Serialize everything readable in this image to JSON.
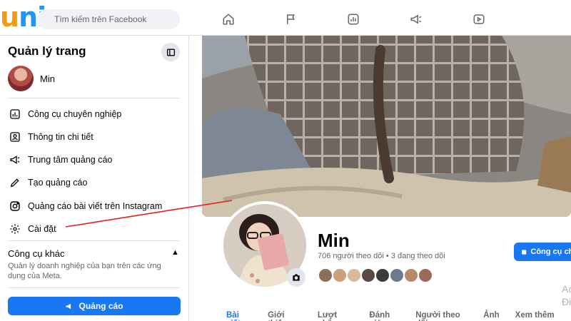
{
  "brand": {
    "logo_text_u": "u",
    "logo_text_nica": "nica"
  },
  "topbar": {
    "search_placeholder": "Tìm kiếm trên Facebook",
    "nav_icons": [
      "home-icon",
      "flag-icon",
      "insights-icon",
      "megaphone-icon",
      "video-icon"
    ]
  },
  "sidebar": {
    "title": "Quản lý trang",
    "profile_name": "Min",
    "items": [
      {
        "label": "Công cụ chuyên nghiệp",
        "icon": "bar-chart-icon"
      },
      {
        "label": "Thông tin chi tiết",
        "icon": "insights-icon"
      },
      {
        "label": "Trung tâm quảng cáo",
        "icon": "megaphone-icon"
      },
      {
        "label": "Tạo quảng cáo",
        "icon": "pencil-icon"
      },
      {
        "label": "Quảng cáo bài viết trên Instagram",
        "icon": "instagram-icon"
      },
      {
        "label": "Cài đặt",
        "icon": "gear-icon"
      }
    ],
    "other_tools_title": "Công cụ khác",
    "other_tools_desc": "Quản lý doanh nghiệp của bạn trên các ứng dụng của Meta.",
    "ad_button_label": "Quảng cáo"
  },
  "page": {
    "name": "Min",
    "followers_text": "706 người theo dõi • 3 đang theo dõi",
    "pro_button_label": "Công cụ chu",
    "tabs": [
      "Bài viết",
      "Giới thiệu",
      "Lượt nhắc",
      "Đánh giá",
      "Người theo dõi",
      "Ảnh",
      "Xem thêm ▾"
    ],
    "active_tab": "Bài viết",
    "friend_colors": [
      "#8b6f5a",
      "#c9a27a",
      "#d9b99b",
      "#5a4a44",
      "#3b3b3b",
      "#6d7a8a",
      "#b88a6a",
      "#9a6a5a"
    ],
    "watermark": "Ac\nĐi"
  },
  "colors": {
    "accent": "#1877f2",
    "annotation": "#e02020"
  }
}
